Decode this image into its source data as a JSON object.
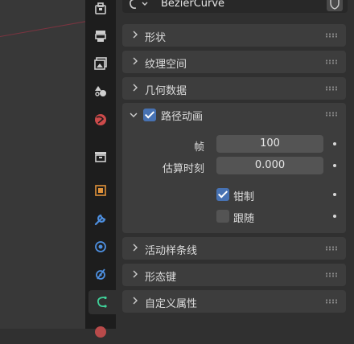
{
  "header": {
    "datablock_name": "BezierCurve"
  },
  "panels": {
    "shape": "形状",
    "texture_space": "纹理空间",
    "geometry": "几何数据",
    "path_animation": "路径动画",
    "active_spline": "活动样条线",
    "shape_keys": "形态键",
    "custom_properties": "自定义属性"
  },
  "path_animation": {
    "enabled": true,
    "frames_label": "帧",
    "frames_value": "100",
    "eval_time_label": "估算时刻",
    "eval_time_value": "0.000",
    "clamp_label": "钳制",
    "clamp_checked": true,
    "follow_label": "跟随",
    "follow_checked": false
  },
  "tabs": [
    "tool-icon",
    "render-icon",
    "output-icon",
    "view-layer-icon",
    "scene-icon",
    "world-icon",
    "collection-icon",
    "object-icon",
    "modifier-icon",
    "particles-icon",
    "physics-icon",
    "curve-data-icon",
    "material-icon"
  ],
  "colors": {
    "accent": "#4772b3",
    "curve_icon": "#3fd29a",
    "modifier_icon": "#4d8fe0",
    "object_icon": "#e0923a",
    "scene_icon": "#cc4a4a"
  }
}
